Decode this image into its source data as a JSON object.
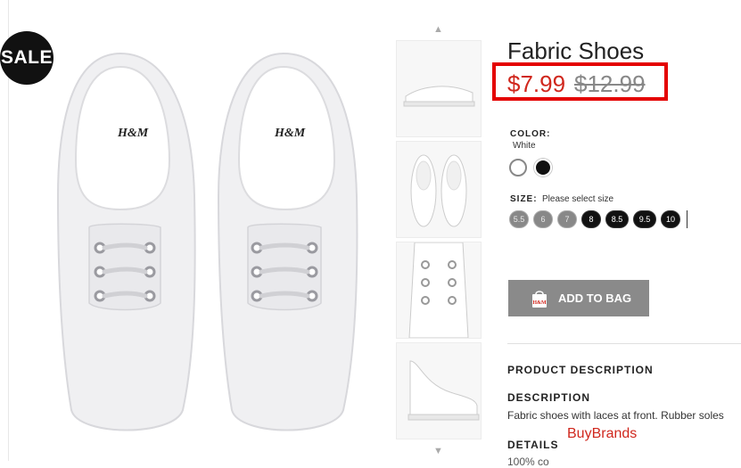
{
  "product": {
    "title": "Fabric Shoes",
    "price_sale": "$7.99",
    "price_original": "$12.99",
    "sale_badge": "SALE",
    "brand_mark": "H&M"
  },
  "color": {
    "label": "COLOR:",
    "selected": "White",
    "options": [
      {
        "name": "White",
        "hex": "#ffffff"
      },
      {
        "name": "Black",
        "hex": "#111111"
      }
    ]
  },
  "size": {
    "label": "SIZE:",
    "prompt": "Please select size",
    "options": [
      {
        "value": "5.5",
        "available": false
      },
      {
        "value": "6",
        "available": false
      },
      {
        "value": "7",
        "available": false
      },
      {
        "value": "8",
        "available": true
      },
      {
        "value": "8.5",
        "available": true
      },
      {
        "value": "9.5",
        "available": true
      },
      {
        "value": "10",
        "available": true
      }
    ]
  },
  "actions": {
    "add_to_bag": "ADD TO BAG"
  },
  "description": {
    "section_title": "PRODUCT DESCRIPTION",
    "heading": "DESCRIPTION",
    "text": "Fabric shoes with laces at front. Rubber soles",
    "details_heading": "DETAILS",
    "details_partial": "100% co"
  },
  "watermark": "BuyBrands",
  "colors": {
    "sale_red": "#d0271d",
    "highlight_box": "#e40000",
    "button_grey": "#8a8a8a"
  },
  "icons": {
    "thumb_up": "chevron-up-icon",
    "thumb_down": "chevron-down-icon",
    "bag": "shopping-bag-icon"
  }
}
